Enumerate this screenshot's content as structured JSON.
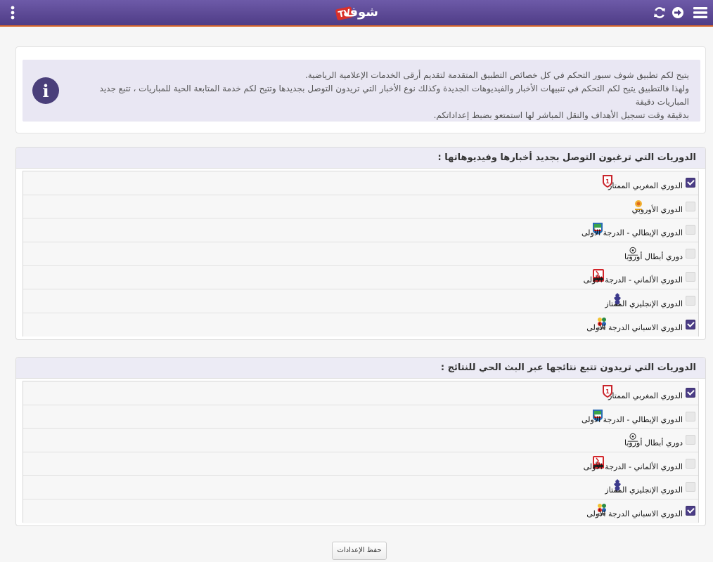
{
  "header": {
    "logo_text": "شوف",
    "logo_badge": "TV"
  },
  "info": {
    "line1": "يتيح لكم تطبيق شوف سبور التحكم في كل خصائص التطبيق المتقدمة لتقديم أرقى الخدمات الإعلامية الرياضية.",
    "line2": "ولهذا فالتطبيق يتيح لكم التحكم في تنبيهات الأخبار والفيديوهات الجديدة وكذلك نوع الأخبار التي تريدون التوصل بجديدها وتتيح لكم خدمة المتابعة الحية للمباريات ، تتبع جديد المباريات دقيقة",
    "line3": "بدقيقة وقت تسجيل الأهداف والنقل المباشر لها استمتعو بضبط إعداداتكم."
  },
  "news_section": {
    "title": "الدوريات التي ترغبون التوصل بجديد أخبارها وفيديوهاتها :",
    "leagues": [
      {
        "name": "الدوري المغربي الممتاز",
        "checked": true,
        "logo": "moroccan-league-logo",
        "logo_right": 120
      },
      {
        "name": "الدوري الأوروبي",
        "checked": false,
        "logo": "europa-league-logo",
        "logo_right": 76
      },
      {
        "name": "الدوري الإيطالي - الدرجة الأولى",
        "checked": false,
        "logo": "serie-a-logo",
        "logo_right": 134
      },
      {
        "name": "دوري أبطال أوروبا",
        "checked": false,
        "logo": "champions-league-logo",
        "logo_right": 84
      },
      {
        "name": "الدوري الألماني - الدرجة الأولى",
        "checked": false,
        "logo": "bundesliga-logo",
        "logo_right": 133
      },
      {
        "name": "الدوري الإنجليزي الممتاز",
        "checked": false,
        "logo": "premier-league-logo",
        "logo_right": 106
      },
      {
        "name": "الدوري الاسباني الدرجة الأولى",
        "checked": true,
        "logo": "la-liga-logo",
        "logo_right": 128
      }
    ]
  },
  "live_section": {
    "title": "الدوريات التي تريدون تتبع نتائجها عبر البث الحي للنتائج :",
    "leagues": [
      {
        "name": "الدوري المغربي الممتاز",
        "checked": true,
        "logo": "moroccan-league-logo",
        "logo_right": 120
      },
      {
        "name": "الدوري الإيطالي - الدرجة الأولى",
        "checked": false,
        "logo": "serie-a-logo",
        "logo_right": 134
      },
      {
        "name": "دوري أبطال أوروبا",
        "checked": false,
        "logo": "champions-league-logo",
        "logo_right": 84
      },
      {
        "name": "الدوري الألماني - الدرجة الأولى",
        "checked": false,
        "logo": "bundesliga-logo",
        "logo_right": 133
      },
      {
        "name": "الدوري الإنجليزي الممتاز",
        "checked": false,
        "logo": "premier-league-logo",
        "logo_right": 106
      },
      {
        "name": "الدوري الاسباني الدرجة الأولى",
        "checked": true,
        "logo": "la-liga-logo",
        "logo_right": 128
      }
    ]
  },
  "save_label": "حفظ الإعدادات",
  "colors": {
    "header": "#5b4894",
    "accent": "#d9672a",
    "checkbox_on": "#4b3d86"
  }
}
